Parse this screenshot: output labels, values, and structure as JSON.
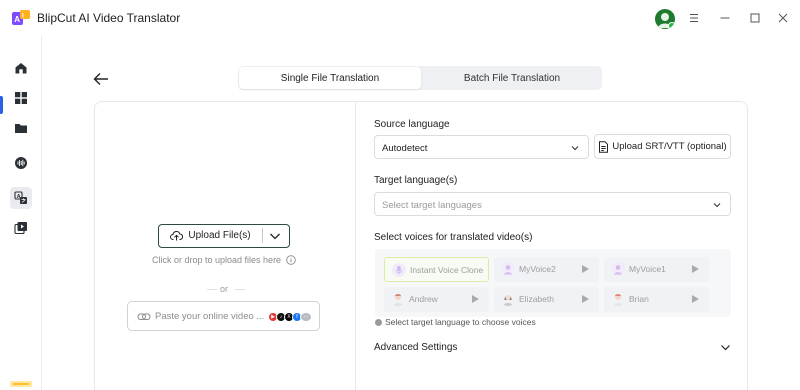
{
  "app": {
    "title": "BlipCut AI Video Translator",
    "logo_letters": "AI",
    "brand_colors": {
      "logo_purple": "#7b4dff",
      "logo_yellow": "#ffb21e",
      "avatar_green": "#1d7a2f",
      "online_dot": "#25b540"
    }
  },
  "window_controls": [
    "menu-icon",
    "minimize-icon",
    "maximize-icon",
    "close-icon"
  ],
  "sidebar": {
    "items": [
      {
        "name": "home-icon",
        "active": false
      },
      {
        "name": "grid-icon",
        "active": false
      },
      {
        "name": "folder-icon",
        "active": false
      },
      {
        "name": "audio-wave-icon",
        "active": false
      },
      {
        "name": "translate-icon",
        "active": true
      },
      {
        "name": "video-add-icon",
        "active": false
      }
    ]
  },
  "tabs": [
    {
      "label": "Single File Translation",
      "active": true
    },
    {
      "label": "Batch File Translation",
      "active": false
    }
  ],
  "upload": {
    "button_label": "Upload File(s)",
    "drop_hint": "Click or drop to upload files here",
    "or_label": "or",
    "url_placeholder": "Paste your online video ...",
    "platforms": [
      "youtube",
      "tiktok",
      "x",
      "facebook",
      "more"
    ]
  },
  "source_language": {
    "label": "Source language",
    "value": "Autodetect",
    "srt_button": "Upload SRT/VTT (optional)"
  },
  "target_language": {
    "label": "Target language(s)",
    "placeholder": "Select target languages"
  },
  "voices": {
    "label": "Select voices for translated video(s)",
    "items": [
      {
        "name": "Instant Voice Clone",
        "selected": true,
        "playable": false
      },
      {
        "name": "MyVoice2",
        "selected": false,
        "playable": true
      },
      {
        "name": "MyVoice1",
        "selected": false,
        "playable": true
      },
      {
        "name": "Andrew",
        "selected": false,
        "playable": true
      },
      {
        "name": "Elizabeth",
        "selected": false,
        "playable": true
      },
      {
        "name": "Brian",
        "selected": false,
        "playable": true
      }
    ],
    "hint": "Select target language to choose voices"
  },
  "advanced": {
    "label": "Advanced Settings"
  }
}
